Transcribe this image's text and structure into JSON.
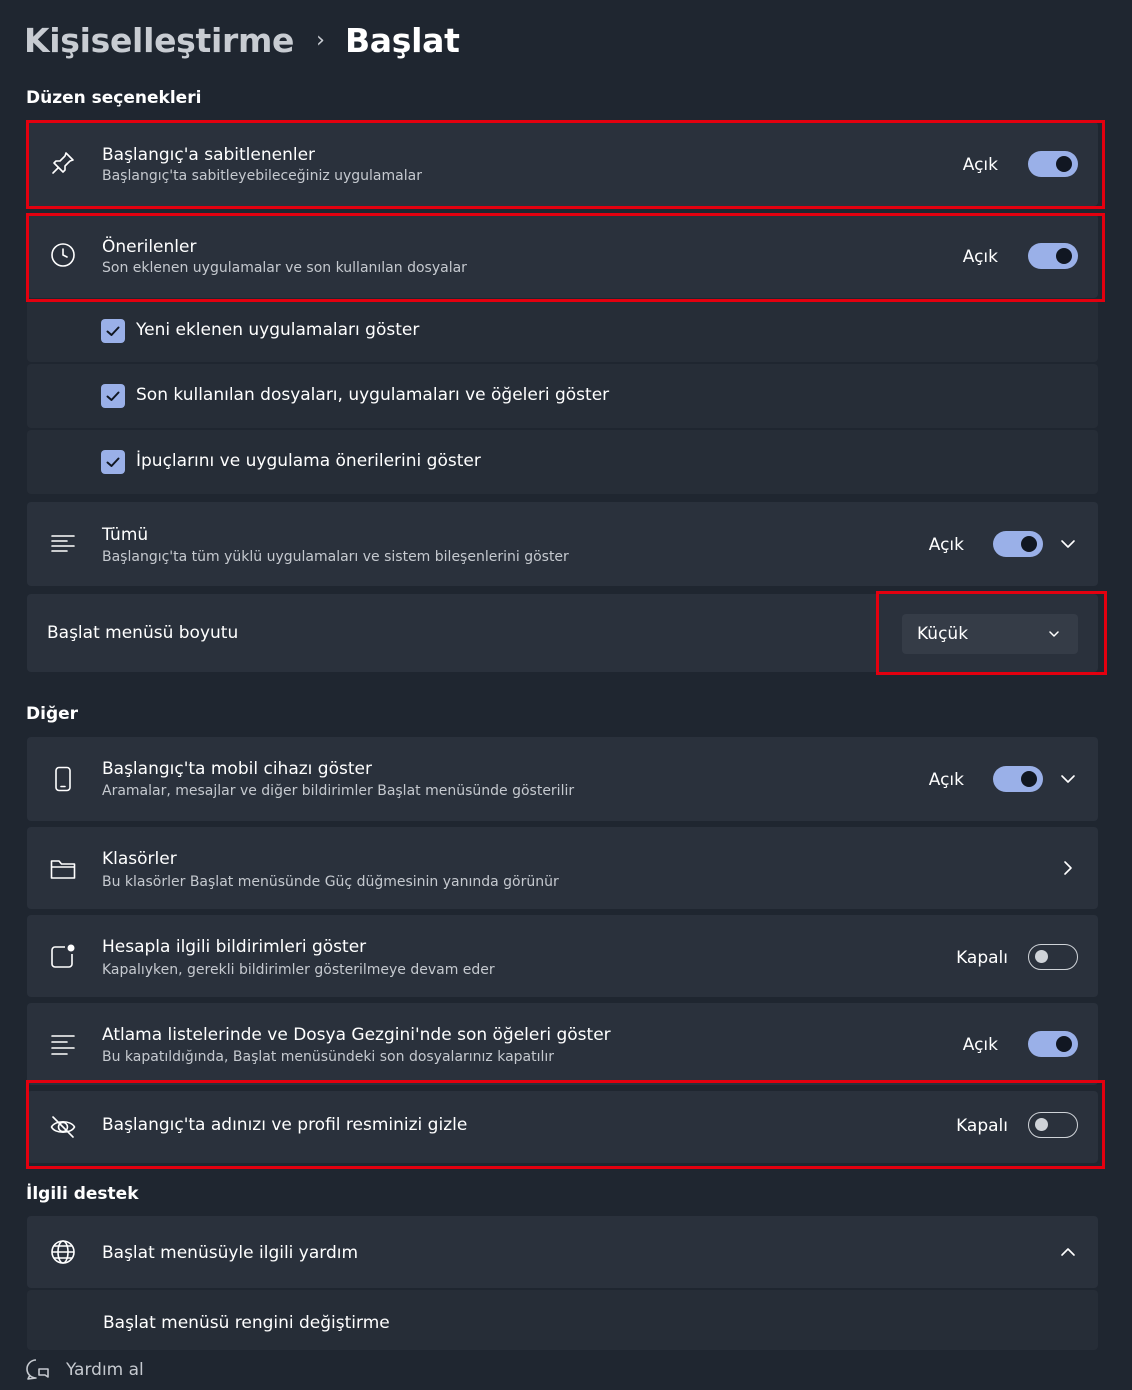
{
  "breadcrumb": {
    "parent": "Kişiselleştirme",
    "separator": "›",
    "current": "Başlat"
  },
  "sections": {
    "layout": "Düzen seçenekleri",
    "other": "Diğer",
    "support": "İlgili destek"
  },
  "layout_items": {
    "pinned": {
      "title": "Başlangıç'a sabitlenenler",
      "desc": "Başlangıç'ta sabitleyebileceğiniz uygulamalar",
      "state": "Açık"
    },
    "recommended": {
      "title": "Önerilenler",
      "desc": "Son eklenen uygulamalar ve son kullanılan dosyalar",
      "state": "Açık"
    },
    "checks": [
      {
        "label": "Yeni eklenen uygulamaları göster"
      },
      {
        "label": "Son kullanılan dosyaları, uygulamaları ve öğeleri göster"
      },
      {
        "label": "İpuçlarını ve uygulama önerilerini göster"
      }
    ],
    "all": {
      "title": "Tümü",
      "desc": "Başlangıç'ta tüm yüklü uygulamaları ve sistem bileşenlerini göster",
      "state": "Açık"
    },
    "size": {
      "title": "Başlat menüsü boyutu",
      "value": "Küçük"
    }
  },
  "other_items": {
    "mobile": {
      "title": "Başlangıç'ta mobil cihazı göster",
      "desc": "Aramalar, mesajlar ve diğer bildirimler Başlat menüsünde gösterilir",
      "state": "Açık"
    },
    "folders": {
      "title": "Klasörler",
      "desc": "Bu klasörler Başlat menüsünde Güç düğmesinin yanında görünür"
    },
    "account": {
      "title": "Hesapla ilgili bildirimleri göster",
      "desc": "Kapalıyken, gerekli bildirimler gösterilmeye devam eder",
      "state": "Kapalı"
    },
    "jumplists": {
      "title": "Atlama listelerinde ve Dosya Gezgini'nde son öğeleri göster",
      "desc": "Bu kapatıldığında, Başlat menüsündeki son dosyalarınız kapatılır",
      "state": "Açık"
    },
    "hide_profile": {
      "title": "Başlangıç'ta adınızı ve profil resminizi gizle",
      "state": "Kapalı"
    }
  },
  "support_items": {
    "help": {
      "title": "Başlat menüsüyle ilgili yardım"
    },
    "link": {
      "title": "Başlat menüsü rengini değiştirme"
    }
  },
  "footer": {
    "get_help": "Yardım al"
  },
  "colors": {
    "accent": "#9ab0e8",
    "highlight": "#e3000f",
    "background": "#1f2630",
    "card": "#2a313c"
  }
}
